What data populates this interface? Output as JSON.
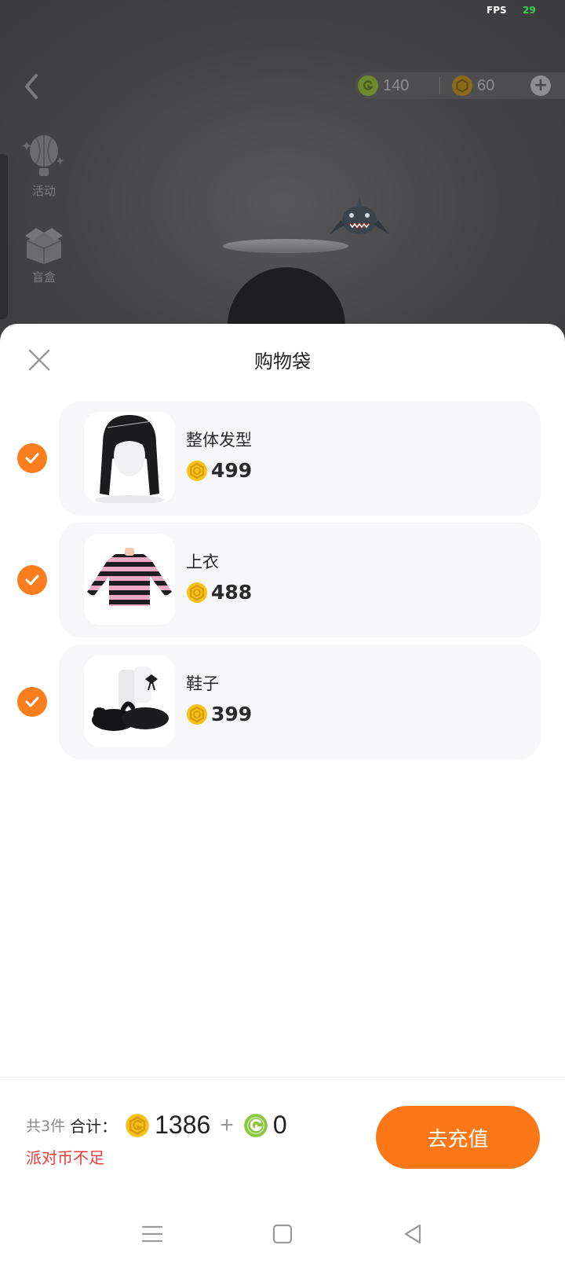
{
  "status": {
    "fps_label": "FPS",
    "fps_value": "29"
  },
  "topbar": {
    "g_coin_amount": "140",
    "party_coin_amount": "60"
  },
  "side_menu": {
    "activity_label": "活动",
    "blind_box_label": "盲盒"
  },
  "sheet": {
    "title": "购物袋",
    "items": [
      {
        "name": "整体发型",
        "price": "499",
        "checked": true,
        "icon": "hair-thumbnail"
      },
      {
        "name": "上衣",
        "price": "488",
        "checked": true,
        "icon": "striped-top-thumbnail"
      },
      {
        "name": "鞋子",
        "price": "399",
        "checked": true,
        "icon": "shoes-thumbnail"
      }
    ]
  },
  "footer": {
    "count_text": "共3件",
    "total_label": "合计：",
    "party_coin_total": "1386",
    "plus": "+",
    "g_coin_total": "0",
    "warning": "派对币不足",
    "recharge_label": "去充值"
  },
  "colors": {
    "accent": "#fb7718",
    "warning": "#ef3a3a",
    "party_coin": "#f7c21a",
    "g_coin": "#8cc63f"
  }
}
